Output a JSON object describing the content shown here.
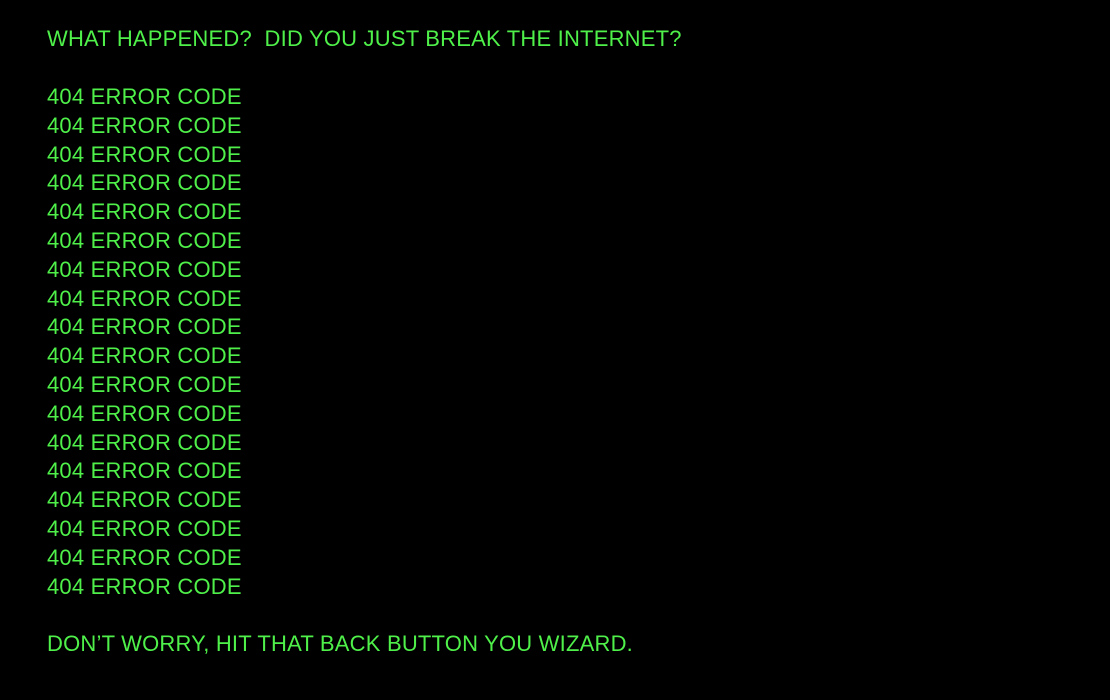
{
  "theme": {
    "background": "#000000",
    "text_color": "#4ff04a"
  },
  "headline": "WHAT HAPPENED?  DID YOU JUST BREAK THE INTERNET?",
  "error_lines": [
    "404 ERROR CODE",
    "404 ERROR CODE",
    "404 ERROR CODE",
    "404 ERROR CODE",
    "404 ERROR CODE",
    "404 ERROR CODE",
    "404 ERROR CODE",
    "404 ERROR CODE",
    "404 ERROR CODE",
    "404 ERROR CODE",
    "404 ERROR CODE",
    "404 ERROR CODE",
    "404 ERROR CODE",
    "404 ERROR CODE",
    "404 ERROR CODE",
    "404 ERROR CODE",
    "404 ERROR CODE",
    "404 ERROR CODE"
  ],
  "footer": "DON’T WORRY, HIT THAT BACK BUTTON YOU WIZARD."
}
